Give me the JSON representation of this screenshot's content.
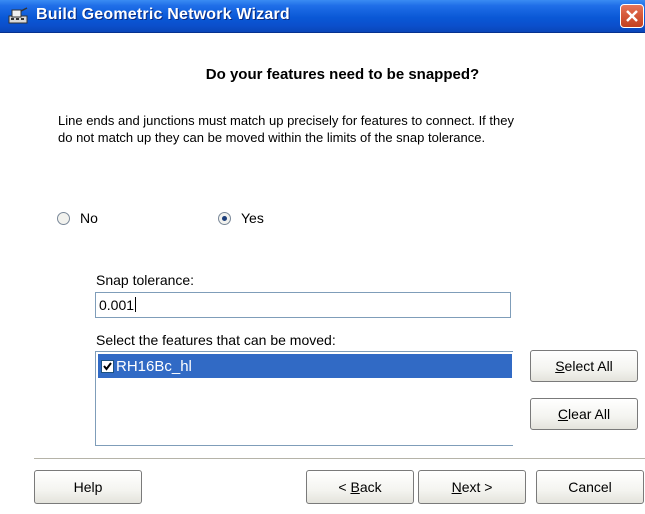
{
  "window": {
    "title": "Build Geometric Network Wizard"
  },
  "heading": "Do your features need to be snapped?",
  "description": "Line ends and junctions must match up precisely for features to connect.  If they do not match up they can be moved within the limits of the snap tolerance.",
  "radios": {
    "no": {
      "label": "No",
      "checked": false
    },
    "yes": {
      "label": "Yes",
      "checked": true
    }
  },
  "snap": {
    "label": "Snap tolerance:",
    "value": "0.001"
  },
  "features": {
    "label": "Select the features that can be moved:",
    "items": [
      {
        "label": "RH16Bc_hl",
        "checked": true,
        "selected": true
      }
    ]
  },
  "buttons": {
    "select_all": {
      "accel": "S",
      "rest": "elect All"
    },
    "clear_all": {
      "accel": "C",
      "rest": "lear All"
    },
    "help": "Help",
    "back": {
      "prefix": "< ",
      "accel": "B",
      "rest": "ack"
    },
    "next": {
      "accel": "N",
      "rest": "ext >"
    },
    "cancel": "Cancel"
  },
  "colors": {
    "titlebar": "#0a58d6",
    "selection": "#316ac5",
    "close": "#d65a3b"
  }
}
